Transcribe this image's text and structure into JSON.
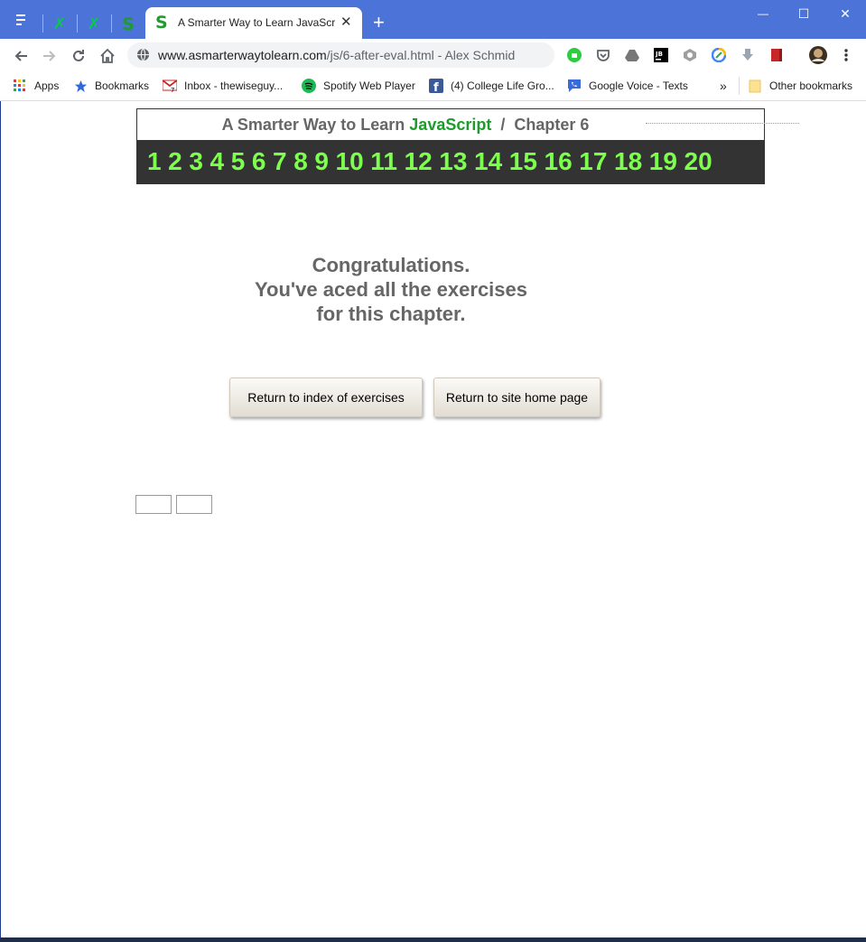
{
  "browser": {
    "active_tab_title": "A Smarter Way to Learn JavaScript",
    "tab_close_glyph": "✕",
    "new_tab_glyph": "+",
    "pinned_tabs": [
      {
        "icon": "deviantart-icon",
        "glyph": "✗"
      },
      {
        "icon": "deviantart-icon",
        "glyph": "✗"
      },
      {
        "icon": "smarter-way-s-icon",
        "glyph": "S"
      }
    ],
    "window_controls": {
      "minimize": "—",
      "maximize": "☐",
      "close": "✕"
    },
    "url_main": "www.asmarterwaytolearn.com",
    "url_path": "/js/6-after-eval.html - Alex Schmid",
    "bookmarks": [
      {
        "label": "Apps",
        "icon": "apps-grid-icon"
      },
      {
        "label": "Bookmarks",
        "icon": "star-icon"
      },
      {
        "label": "Inbox - thewiseguy...",
        "icon": "gmail-icon"
      },
      {
        "label": "Spotify Web Player",
        "icon": "spotify-icon"
      },
      {
        "label": "(4) College Life Gro...",
        "icon": "facebook-icon"
      },
      {
        "label": "Google Voice - Texts",
        "icon": "google-voice-icon"
      }
    ],
    "bookmarks_overflow": "»",
    "other_bookmarks": "Other bookmarks",
    "colors": {
      "titlebar": "#4c74d8",
      "accent_green": "#1f9a2d",
      "chapter_green": "#7dff4d"
    }
  },
  "page": {
    "header": {
      "prefix": "A Smarter Way to Learn ",
      "brand": "JavaScript",
      "separator": "/",
      "chapter": "Chapter 6"
    },
    "chapters": [
      "1",
      "2",
      "3",
      "4",
      "5",
      "6",
      "7",
      "8",
      "9",
      "10",
      "11",
      "12",
      "13",
      "14",
      "15",
      "16",
      "17",
      "18",
      "19",
      "20"
    ],
    "congrats_lines": [
      "Congratulations.",
      "You've aced all the exercises",
      "for this chapter."
    ],
    "buttons": {
      "index": "Return to index of exercises",
      "home": "Return to site home page"
    }
  }
}
